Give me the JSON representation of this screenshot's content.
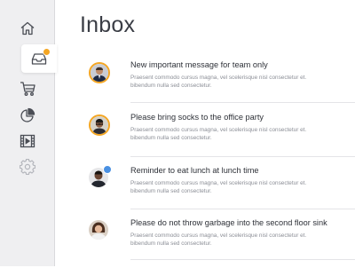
{
  "sidebar": {
    "items": [
      {
        "name": "home-icon",
        "active": false
      },
      {
        "name": "inbox-icon",
        "active": true,
        "has_badge": true
      },
      {
        "name": "cart-icon",
        "active": false
      },
      {
        "name": "pie-chart-icon",
        "active": false
      },
      {
        "name": "film-icon",
        "active": false
      },
      {
        "name": "gear-icon",
        "active": false,
        "dimmed": true
      }
    ]
  },
  "main": {
    "title": "Inbox",
    "messages": [
      {
        "title": "New important message for team only",
        "preview": "Praesent commodo cursus magna, vel scelerisque nisl consectetur et. bibendum nulla sed consectetur.",
        "avatar": "avatar-man-suit",
        "highlighted": true
      },
      {
        "title": "Please bring socks to the office party",
        "preview": "Praesent commodo cursus magna, vel scelerisque nisl consectetur et. bibendum nulla sed consectetur.",
        "avatar": "avatar-man-glasses",
        "highlighted": true
      },
      {
        "title": "Reminder to eat lunch at lunch time",
        "preview": "Praesent commodo cursus magna, vel scelerisque nisl consectetur et. bibendum nulla sed consectetur.",
        "avatar": "avatar-man-dark",
        "highlighted": false,
        "badge": true
      },
      {
        "title": "Please do not throw garbage into the second floor sink",
        "preview": "Praesent commodo cursus magna, vel scelerisque nisl consectetur et. bibendum nulla sed consectetur.",
        "avatar": "avatar-woman",
        "highlighted": false
      }
    ]
  },
  "colors": {
    "accent_orange": "#f4a623",
    "accent_blue": "#4a90e2",
    "sidebar_bg": "#efeff1"
  }
}
